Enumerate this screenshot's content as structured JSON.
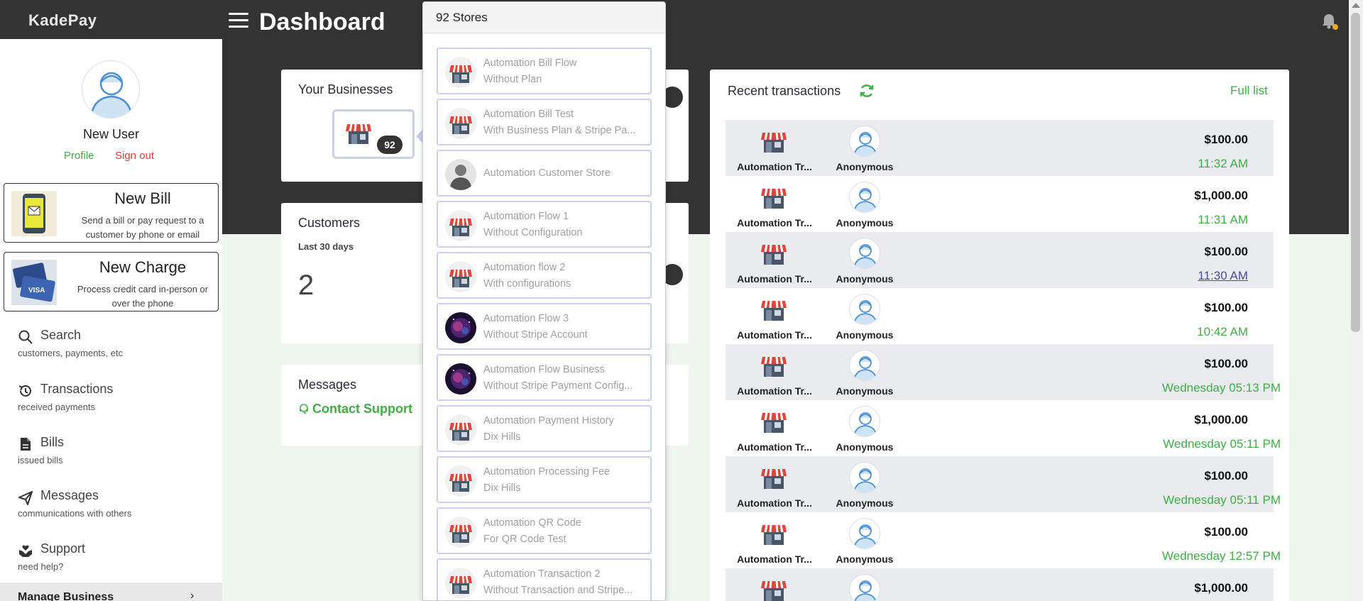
{
  "app": {
    "logo": "KadePay",
    "page_title": "Dashboard"
  },
  "user": {
    "name": "New User",
    "profile_label": "Profile",
    "signout_label": "Sign out"
  },
  "actions": {
    "new_bill": {
      "title": "New Bill",
      "desc": "Send a bill or pay request to a customer by phone or email"
    },
    "new_charge": {
      "title": "New Charge",
      "desc": "Process credit card in-person or over the phone"
    }
  },
  "nav": [
    {
      "label": "Search",
      "sub": "customers, payments, etc",
      "icon": "search-icon"
    },
    {
      "label": "Transactions",
      "sub": "received payments",
      "icon": "history-icon"
    },
    {
      "label": "Bills",
      "sub": "issued bills",
      "icon": "document-icon"
    },
    {
      "label": "Messages",
      "sub": "communications with others",
      "icon": "send-icon"
    },
    {
      "label": "Support",
      "sub": "need help?",
      "icon": "support-hands-icon"
    }
  ],
  "manage": {
    "label": "Manage Business",
    "chevron": "›"
  },
  "businesses": {
    "title": "Your Businesses",
    "count": "92"
  },
  "customers": {
    "title": "Customers",
    "period": "Last 30 days",
    "count": "2"
  },
  "messages": {
    "title": "Messages",
    "contact_label": "Contact Support"
  },
  "stores": {
    "header": "92 Stores",
    "items": [
      {
        "name": "Automation Bill Flow",
        "sub": "Without Plan",
        "icon": "store-icon"
      },
      {
        "name": "Automation Bill Test",
        "sub": "With Business Plan & Stripe Pa...",
        "icon": "store-icon"
      },
      {
        "name": "Automation Customer Store",
        "sub": "",
        "icon": "person-photo-icon"
      },
      {
        "name": "Automation Flow 1",
        "sub": "Without Configuration",
        "icon": "store-icon"
      },
      {
        "name": "Automation flow 2",
        "sub": "With configurations",
        "icon": "store-icon"
      },
      {
        "name": "Automation Flow 3",
        "sub": "Without Stripe Account",
        "icon": "galaxy-photo-icon"
      },
      {
        "name": "Automation Flow Business",
        "sub": "Without Stripe Payment Config...",
        "icon": "galaxy-photo-icon"
      },
      {
        "name": "Automation Payment History",
        "sub": "Dix Hills",
        "icon": "store-icon"
      },
      {
        "name": "Automation Processing Fee",
        "sub": "Dix Hills",
        "icon": "store-icon"
      },
      {
        "name": "Automation QR Code",
        "sub": "For QR Code Test",
        "icon": "store-icon"
      },
      {
        "name": "Automation Transaction 2",
        "sub": "Without Transaction and Stripe...",
        "icon": "store-icon"
      }
    ]
  },
  "transactions": {
    "title": "Recent transactions",
    "full_list_label": "Full list",
    "rows": [
      {
        "store": "Automation Tr...",
        "customer": "Anonymous",
        "amount": "$100.00",
        "time": "11:32 AM"
      },
      {
        "store": "Automation Tr...",
        "customer": "Anonymous",
        "amount": "$1,000.00",
        "time": "11:31 AM"
      },
      {
        "store": "Automation Tr...",
        "customer": "Anonymous",
        "amount": "$100.00",
        "time": "11:30 AM"
      },
      {
        "store": "Automation Tr...",
        "customer": "Anonymous",
        "amount": "$100.00",
        "time": "10:42 AM"
      },
      {
        "store": "Automation Tr...",
        "customer": "Anonymous",
        "amount": "$100.00",
        "time": "Wednesday 05:13 PM"
      },
      {
        "store": "Automation Tr...",
        "customer": "Anonymous",
        "amount": "$1,000.00",
        "time": "Wednesday 05:11 PM"
      },
      {
        "store": "Automation Tr...",
        "customer": "Anonymous",
        "amount": "$100.00",
        "time": "Wednesday 05:11 PM"
      },
      {
        "store": "Automation Tr...",
        "customer": "Anonymous",
        "amount": "$100.00",
        "time": "Wednesday 12:57 PM"
      },
      {
        "store": "",
        "customer": "",
        "amount": "$1,000.00",
        "time": ""
      }
    ]
  },
  "colors": {
    "accent_green": "#3cb043",
    "signout_red": "#e53935",
    "header_dark": "#333333",
    "notification_dot": "#f5a623"
  }
}
